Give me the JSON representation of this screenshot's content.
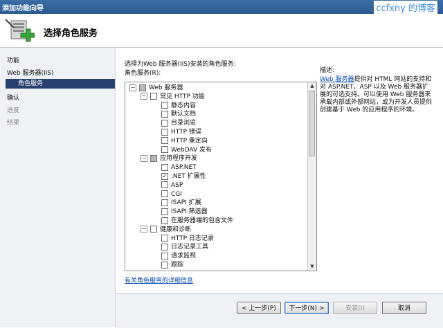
{
  "window": {
    "title": "添加功能向导",
    "watermark": "ccfxny 的博客"
  },
  "header": {
    "title": "选择角色服务"
  },
  "nav": [
    {
      "label": "功能",
      "state": "normal"
    },
    {
      "label": "Web 服务器(IIS)",
      "state": "normal"
    },
    {
      "label": "角色服务",
      "state": "selected"
    },
    {
      "label": "确认",
      "state": "normal"
    },
    {
      "label": "进度",
      "state": "dim"
    },
    {
      "label": "结果",
      "state": "dim"
    }
  ],
  "main": {
    "instruction": "选择为Web 服务器(IIS)安装的角色服务:",
    "list_label": "角色服务(R):",
    "tree": [
      {
        "label": "Web 服务器",
        "level": 0,
        "expand": "-",
        "check": "partial"
      },
      {
        "label": "常见 HTTP 功能",
        "level": 1,
        "expand": "-",
        "check": "empty"
      },
      {
        "label": "静态内容",
        "level": 2,
        "check": "empty"
      },
      {
        "label": "默认文档",
        "level": 2,
        "check": "empty"
      },
      {
        "label": "目录浏览",
        "level": 2,
        "check": "empty"
      },
      {
        "label": "HTTP 错误",
        "level": 2,
        "check": "empty"
      },
      {
        "label": "HTTP 重定向",
        "level": 2,
        "check": "empty"
      },
      {
        "label": "WebDAV 发布",
        "level": 2,
        "check": "empty"
      },
      {
        "label": "应用程序开发",
        "level": 1,
        "expand": "-",
        "check": "partial"
      },
      {
        "label": "ASP.NET",
        "level": 2,
        "check": "empty"
      },
      {
        "label": ".NET 扩展性",
        "level": 2,
        "check": "checked"
      },
      {
        "label": "ASP",
        "level": 2,
        "check": "empty"
      },
      {
        "label": "CGI",
        "level": 2,
        "check": "empty"
      },
      {
        "label": "ISAPI 扩展",
        "level": 2,
        "check": "empty"
      },
      {
        "label": "ISAPI 筛选器",
        "level": 2,
        "check": "empty"
      },
      {
        "label": "在服务器端的包含文件",
        "level": 2,
        "check": "empty"
      },
      {
        "label": "健康和诊断",
        "level": 1,
        "expand": "-",
        "check": "empty"
      },
      {
        "label": "HTTP 日志记录",
        "level": 2,
        "check": "empty"
      },
      {
        "label": "日志记录工具",
        "level": 2,
        "check": "empty"
      },
      {
        "label": "请求监视",
        "level": 2,
        "check": "empty"
      },
      {
        "label": "跟踪",
        "level": 2,
        "check": "empty"
      }
    ],
    "more_link": "有关角色服务的详细信息"
  },
  "description": {
    "heading": "描述:",
    "link": "Web 服务器",
    "text": "提供对 HTML 网站的支持和对 ASP.NET、ASP 以及 Web 服务器扩展的可选支持。可以使用 Web 服务器来承载内部或外部网站，或为开发人员提供创建基于 Web 的应用程序的环境。"
  },
  "buttons": {
    "back": "< 上一步(P)",
    "next": "下一步(N) >",
    "install": "安装(I)",
    "cancel": "取消"
  }
}
